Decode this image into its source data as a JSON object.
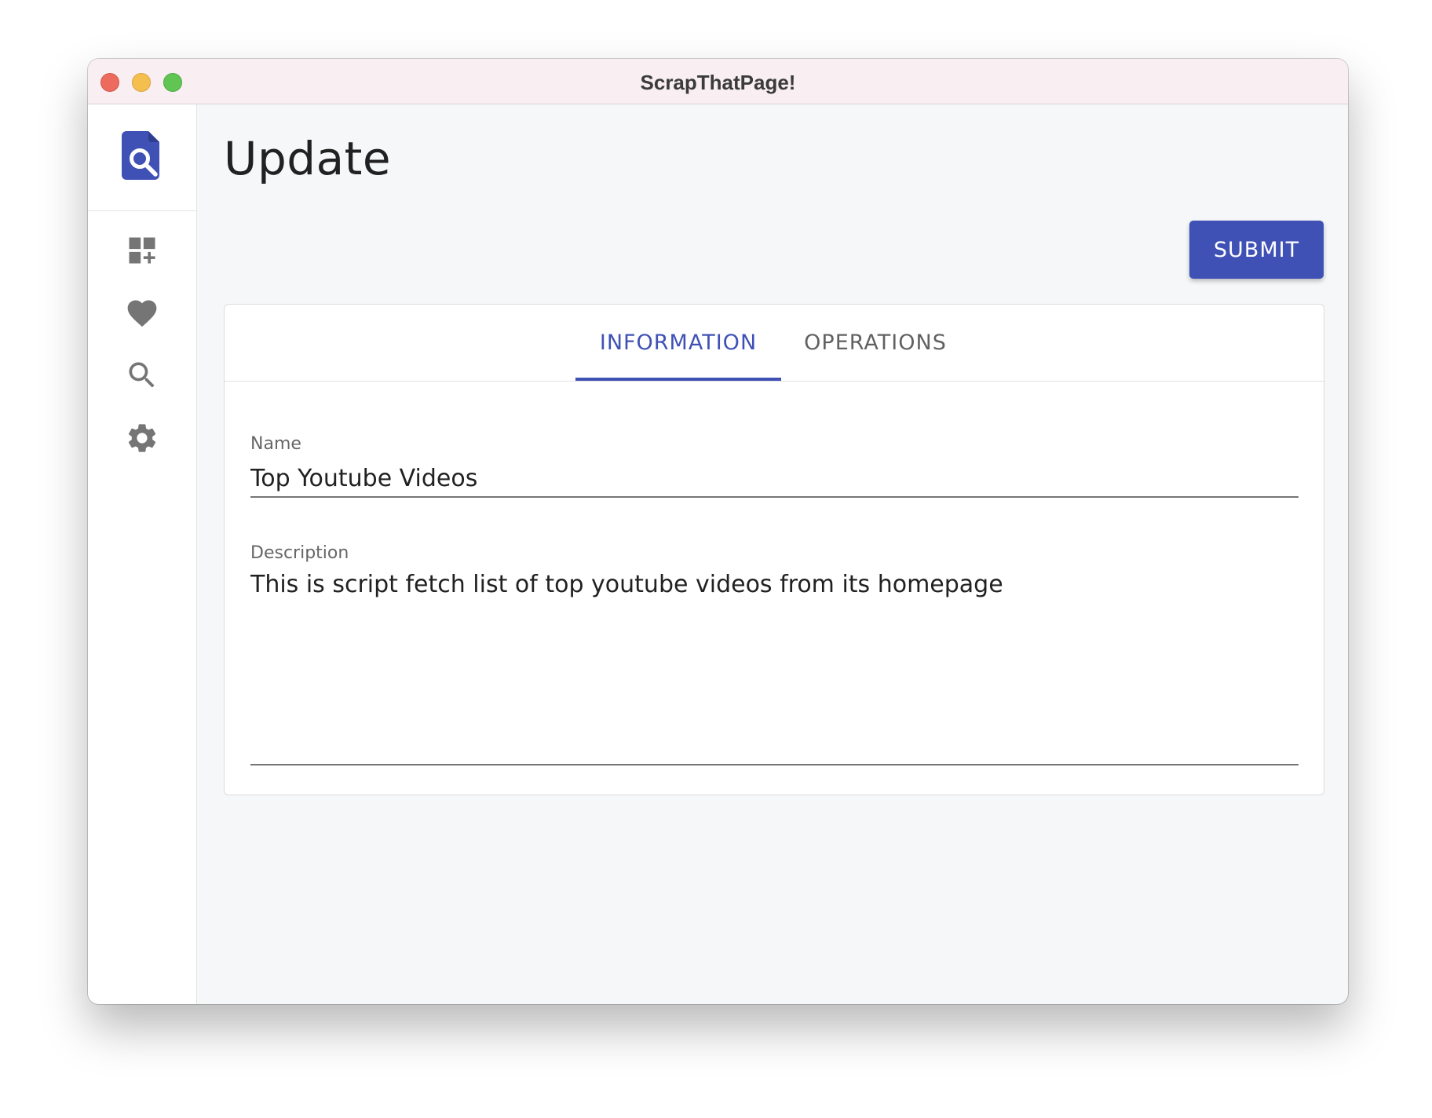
{
  "window": {
    "title": "ScrapThatPage!"
  },
  "sidebar": {
    "logo_icon": "document-search-icon",
    "items": [
      {
        "icon": "dashboard-add-icon",
        "label": "Add Widget"
      },
      {
        "icon": "heart-icon",
        "label": "Favorites"
      },
      {
        "icon": "search-icon",
        "label": "Search"
      },
      {
        "icon": "gear-icon",
        "label": "Settings"
      }
    ]
  },
  "main": {
    "title": "Update",
    "submit_label": "SUBMIT",
    "tabs": [
      {
        "label": "INFORMATION",
        "active": true
      },
      {
        "label": "OPERATIONS",
        "active": false
      }
    ],
    "form": {
      "name_label": "Name",
      "name_value": "Top Youtube Videos",
      "description_label": "Description",
      "description_value": "This is script fetch list of top youtube videos from its homepage"
    }
  },
  "colors": {
    "primary": "#3f51b5",
    "icon_gray": "#757575",
    "background": "#f6f7f9",
    "titlebar": "#f9eef1"
  }
}
